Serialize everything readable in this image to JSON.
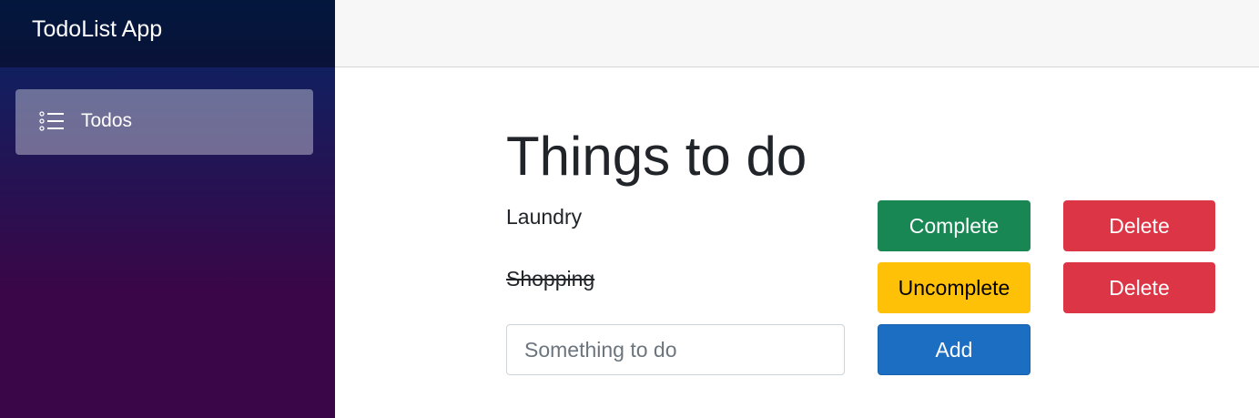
{
  "sidebar": {
    "brand": "TodoList App",
    "nav_items": [
      {
        "label": "Todos",
        "icon": "list-icon",
        "active": true
      }
    ]
  },
  "main": {
    "title": "Things to do",
    "todos": [
      {
        "text": "Laundry",
        "completed": false,
        "toggle_label": "Complete",
        "delete_label": "Delete"
      },
      {
        "text": "Shopping",
        "completed": true,
        "toggle_label": "Uncomplete",
        "delete_label": "Delete"
      }
    ],
    "new_todo": {
      "value": "",
      "placeholder": "Something to do",
      "add_label": "Add"
    }
  },
  "colors": {
    "sidebar_gradient_start": "#052767",
    "sidebar_gradient_end": "#3a0647",
    "complete": "#198754",
    "uncomplete": "#ffc107",
    "delete": "#dc3545",
    "add": "#1b6ec2"
  }
}
